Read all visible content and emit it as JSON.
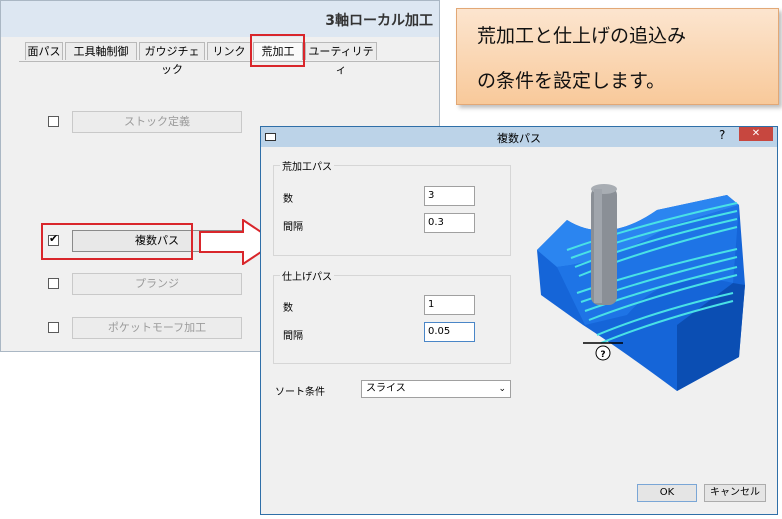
{
  "background_window": {
    "title": "3軸ローカル加工",
    "tabs": [
      {
        "label": "面パス"
      },
      {
        "label": "工具軸制御"
      },
      {
        "label": "ガウジチェック"
      },
      {
        "label": "リンク"
      },
      {
        "label": "荒加工",
        "active": true
      },
      {
        "label": "ユーティリティ"
      }
    ],
    "options": [
      {
        "label": "ストック定義",
        "checked": false,
        "enabled": false
      },
      {
        "label": "複数パス",
        "checked": true,
        "enabled": true
      },
      {
        "label": "プランジ",
        "checked": false,
        "enabled": false
      },
      {
        "label": "ポケットモーフ加工",
        "checked": false,
        "enabled": false
      }
    ],
    "checkmark": "✔"
  },
  "callout": {
    "line1": "荒加工と仕上げの追込み",
    "line2": "の条件を設定します。"
  },
  "dialog": {
    "title": "複数パス",
    "help": "?",
    "close": "✕",
    "rough": {
      "title": "荒加工パス",
      "count_label": "数",
      "count_value": "3",
      "spacing_label": "間隔",
      "spacing_value": "0.3"
    },
    "finish": {
      "title": "仕上げパス",
      "count_label": "数",
      "count_value": "1",
      "spacing_label": "間隔",
      "spacing_value": "0.05"
    },
    "sort_label": "ソート条件",
    "sort_value": "スライス",
    "ok_label": "OK",
    "cancel_label": "キャンセル",
    "illustration_marker": "?"
  },
  "colors": {
    "highlight": "#d9262b",
    "part_blue": "#1565d8",
    "toolpath_cyan": "#49e1e6"
  }
}
